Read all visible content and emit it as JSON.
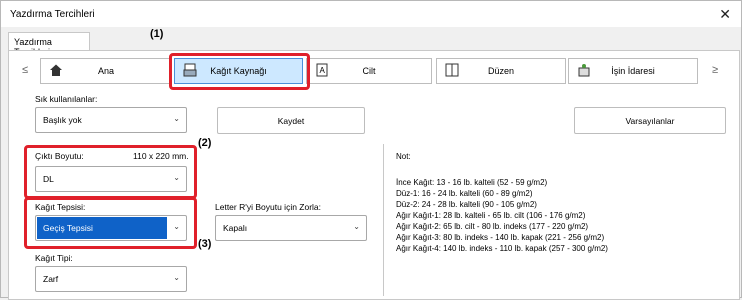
{
  "window": {
    "title": "Yazdırma Tercihleri",
    "close_glyph": "✕"
  },
  "tab": {
    "label": "Yazdırma Tercihleri"
  },
  "nav": {
    "prev": "≤",
    "next": "≥",
    "buttons": [
      {
        "label": "Ana",
        "icon": "home-icon"
      },
      {
        "label": "Kağıt Kaynağı",
        "icon": "paper-tray-icon"
      },
      {
        "label": "Cilt",
        "icon": "binding-icon"
      },
      {
        "label": "Düzen",
        "icon": "layout-icon"
      },
      {
        "label": "İşin İdaresi",
        "icon": "job-handling-icon"
      }
    ]
  },
  "callouts": {
    "c1": "(1)",
    "c2": "(2)",
    "c3": "(3)"
  },
  "favorites": {
    "label": "Sık kullanılanlar:",
    "value": "Başlık yok",
    "save": "Kaydet",
    "defaults": "Varsayılanlar"
  },
  "output_size": {
    "label": "Çıktı Boyutu:",
    "dims": "110 x 220 mm.",
    "value": "DL"
  },
  "paper_tray": {
    "label": "Kağıt Tepsisi:",
    "value": "Geçiş Tepsisi"
  },
  "paper_type": {
    "label": "Kağıt Tipi:",
    "value": "Zarf"
  },
  "force_letter": {
    "label": "Letter R'yi Boyutu için Zorla:",
    "value": "Kapalı"
  },
  "note": {
    "title": "Not:",
    "lines": [
      "İnce Kağıt: 13 - 16 lb. kalteli (52 - 59 g/m2)",
      "Düz-1: 16 - 24 lb. kalteli (60 - 89 g/m2)",
      "Düz-2: 24 - 28 lb. kalteli (90 - 105 g/m2)",
      "Ağır Kağıt-1: 28 lb. kalteli - 65 lb. cilt (106 - 176 g/m2)",
      "Ağır Kağıt-2: 65 lb. cilt - 80 lb. indeks (177 - 220 g/m2)",
      "Ağır Kağıt-3: 80 lb. indeks - 140 lb. kapak (221 - 256 g/m2)",
      "Ağır Kağıt-4: 140 lb. indeks - 110 lb. kapak (257 - 300 g/m2)"
    ]
  },
  "colors": {
    "highlight": "#e0202a",
    "selected": "#0f62c8",
    "selected_button": "#cde8ff"
  }
}
